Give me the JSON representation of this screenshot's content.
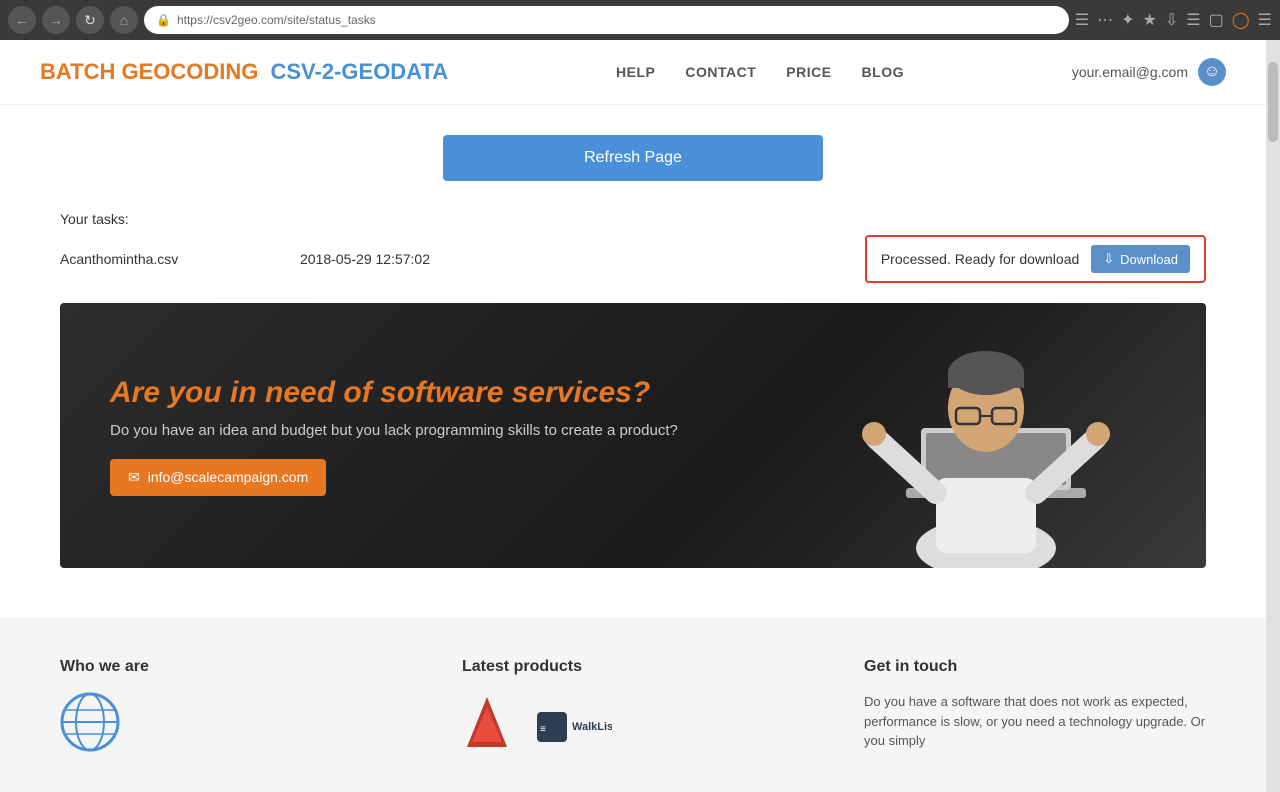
{
  "browser": {
    "url": "https://csv2geo.com/site/status_tasks",
    "back_tooltip": "Back",
    "forward_tooltip": "Forward",
    "refresh_tooltip": "Refresh",
    "home_tooltip": "Home"
  },
  "header": {
    "logo": {
      "part1": "BATCH GEOCODING",
      "part2": "CSV-2-GEODATA"
    },
    "nav": {
      "help": "HELP",
      "contact": "CONTACT",
      "price": "PRICE",
      "blog": "BLOG"
    },
    "user_email": "your.email@g.com"
  },
  "main": {
    "refresh_button_label": "Refresh Page",
    "tasks_label": "Your tasks:",
    "task": {
      "filename": "Acanthomintha.csv",
      "date": "2018-05-29 12:57:02",
      "status_text": "Processed. Ready for download",
      "download_label": "Download"
    }
  },
  "banner": {
    "headline": "Are you in need of software services?",
    "subtext": "Do you have an idea and budget but you lack programming skills to create a product?",
    "email_btn_label": "info@scalecampaign.com"
  },
  "footer": {
    "who_we_are": {
      "title": "Who we are"
    },
    "latest_products": {
      "title": "Latest products"
    },
    "get_in_touch": {
      "title": "Get in touch",
      "body": "Do you have a software that does not work as expected, performance is slow, or you need a technology upgrade. Or you simply"
    }
  }
}
